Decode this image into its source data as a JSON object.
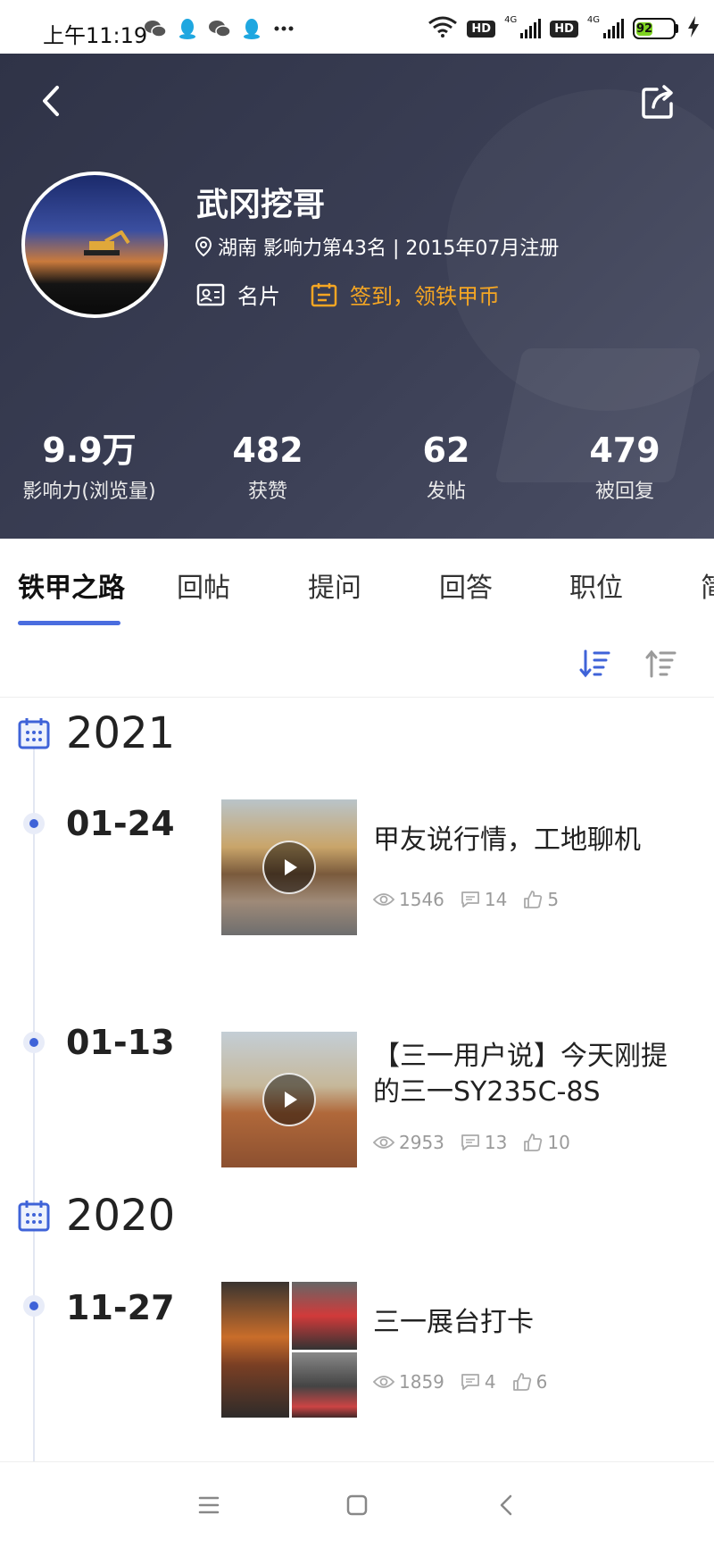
{
  "status_bar": {
    "time": "上午11:19",
    "app_icons": [
      "wechat-icon",
      "qq-icon",
      "wechat-icon",
      "qq-icon",
      "more-dots-icon"
    ],
    "net1": "4G",
    "net2": "4G",
    "hd": "HD",
    "battery": "92"
  },
  "header": {
    "user_name": "武冈挖哥",
    "location_meta": "湖南 影响力第43名 | 2015年07月注册",
    "card_label": "名片",
    "checkin_label": "签到，领铁甲币"
  },
  "stats": [
    {
      "value": "9.9万",
      "label": "影响力(浏览量)"
    },
    {
      "value": "482",
      "label": "获赞"
    },
    {
      "value": "62",
      "label": "发帖"
    },
    {
      "value": "479",
      "label": "被回复"
    }
  ],
  "tabs": [
    "铁甲之路",
    "回帖",
    "提问",
    "回答",
    "职位",
    "简"
  ],
  "timeline": {
    "years": [
      "2021",
      "2020"
    ],
    "posts": [
      {
        "date": "01-24",
        "title": "甲友说行情，工地聊机",
        "views": "1546",
        "comments": "14",
        "likes": "5"
      },
      {
        "date": "01-13",
        "title": "【三一用户说】今天刚提的三一SY235C-8S",
        "views": "2953",
        "comments": "13",
        "likes": "10"
      },
      {
        "date": "11-27",
        "title": "三一展台打卡",
        "views": "1859",
        "comments": "4",
        "likes": "6"
      }
    ]
  },
  "colors": {
    "accent": "#4a6ddf",
    "checkin": "#f5a623",
    "hero_bg": "#363a4f"
  }
}
